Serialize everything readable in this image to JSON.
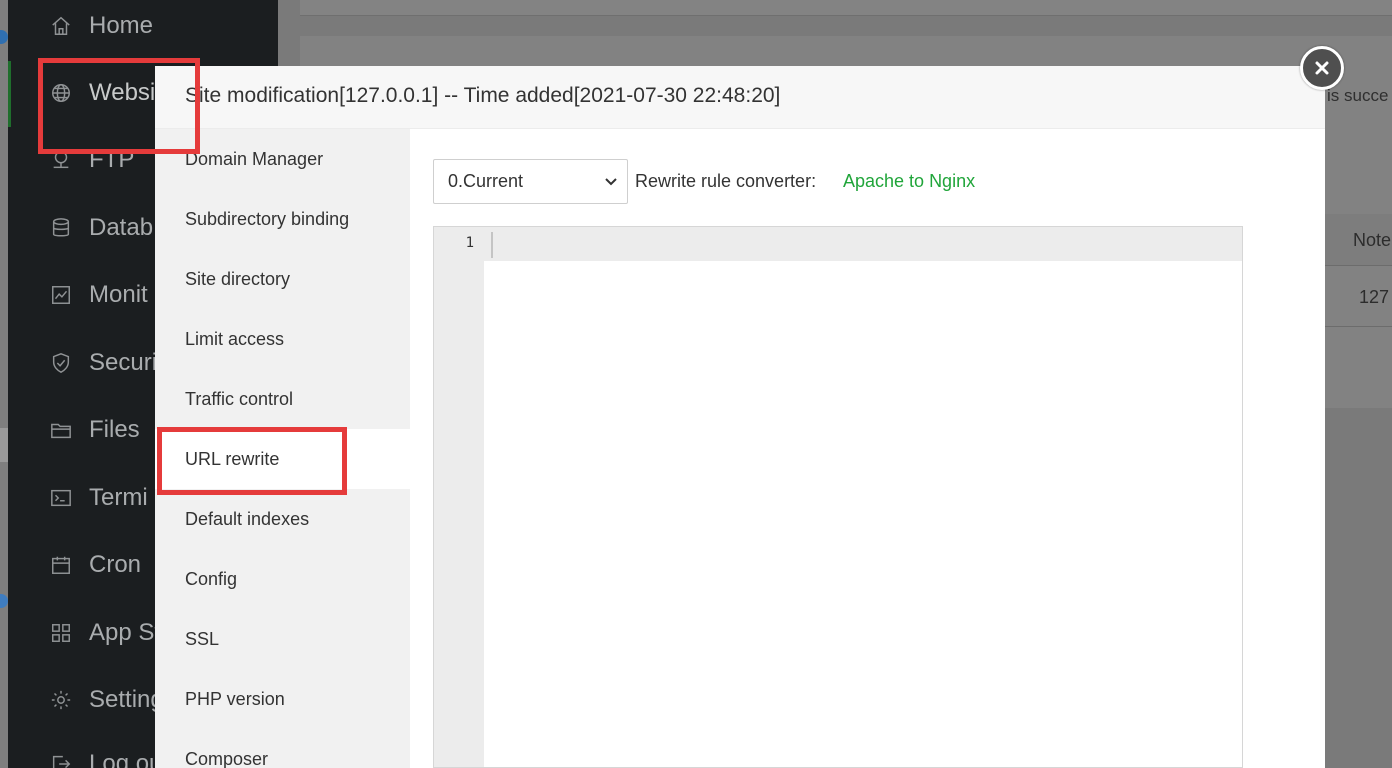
{
  "nav": {
    "items": [
      {
        "label": "Home",
        "icon": "home-icon"
      },
      {
        "label": "Websi",
        "icon": "globe-icon"
      },
      {
        "label": "FTP",
        "icon": "ftp-icon"
      },
      {
        "label": "Datab",
        "icon": "database-icon"
      },
      {
        "label": "Monit",
        "icon": "monitor-icon"
      },
      {
        "label": "Securi",
        "icon": "shield-icon"
      },
      {
        "label": "Files",
        "icon": "folder-icon"
      },
      {
        "label": "Termi",
        "icon": "terminal-icon"
      },
      {
        "label": "Cron",
        "icon": "calendar-icon"
      },
      {
        "label": "App St",
        "icon": "grid-icon"
      },
      {
        "label": "Setting",
        "icon": "gear-icon"
      },
      {
        "label": "Log ou",
        "icon": "logout-icon"
      }
    ]
  },
  "background": {
    "status_text": "is succe",
    "table_header_note": "Note",
    "table_cell_ip": "127"
  },
  "modal": {
    "title": "Site modification[127.0.0.1] -- Time added[2021-07-30 22:48:20]",
    "menu": [
      "Domain Manager",
      "Subdirectory binding",
      "Site directory",
      "Limit access",
      "Traffic control",
      "URL rewrite",
      "Default indexes",
      "Config",
      "SSL",
      "PHP version",
      "Composer"
    ],
    "active_menu": "URL rewrite",
    "rewrite": {
      "selected_template": "0.Current",
      "converter_label": "Rewrite rule converter:",
      "converter_link": "Apache to Nginx"
    },
    "editor": {
      "line_numbers": [
        "1"
      ]
    }
  },
  "colors": {
    "accent_green": "#20a53a",
    "highlight_red": "#e53b3b"
  }
}
